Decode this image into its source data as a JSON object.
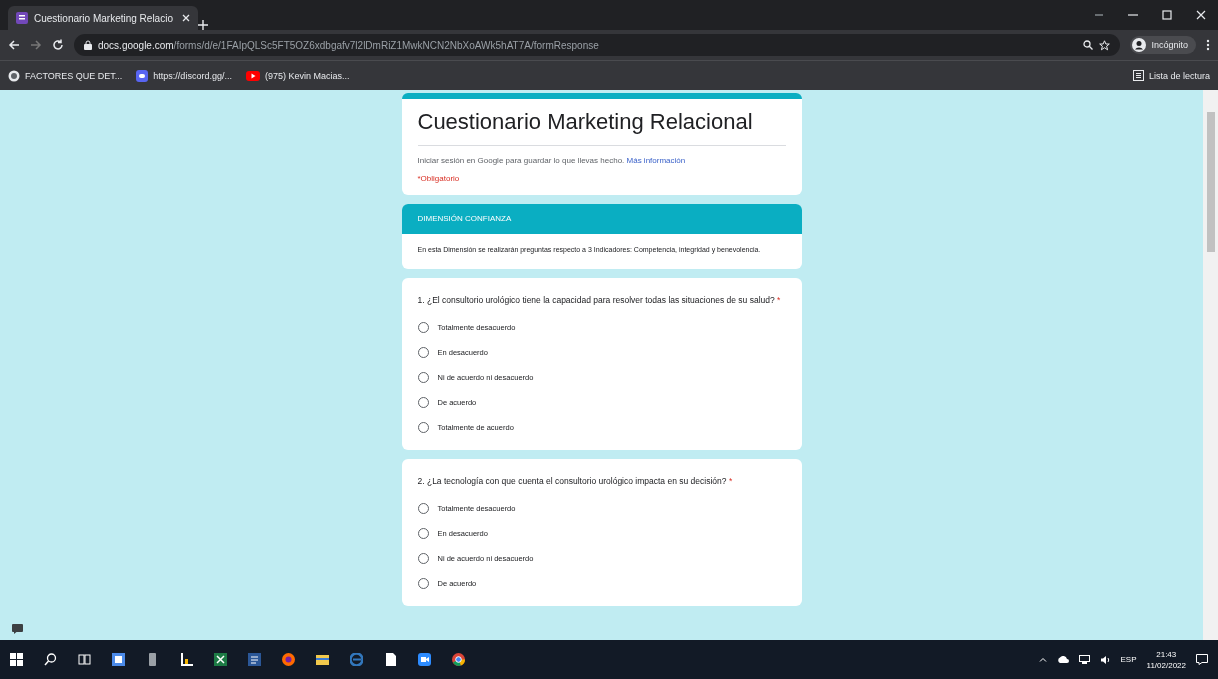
{
  "browser": {
    "tab_title": "Cuestionario Marketing Relacio",
    "url_host": "docs.google.com",
    "url_path": "/forms/d/e/1FAIpQLSc5FT5OZ6xdbgafv7l2lDmRiZ1MwkNCN2NbXoAWk5hAT7A/formResponse",
    "profile": "Incógnito",
    "reading_list": "Lista de lectura",
    "bookmarks": [
      {
        "kind": "site",
        "label": "FACTORES QUE DET..."
      },
      {
        "kind": "chat",
        "label": "https://discord.gg/..."
      },
      {
        "kind": "video",
        "label": "(975) Kevin Macias..."
      }
    ]
  },
  "form": {
    "title": "Cuestionario Marketing Relacional",
    "signin_note": "Iniciar sesión en Google para guardar lo que llevas hecho.",
    "signin_link": "Más información",
    "required_note": "*Obligatorio",
    "section": {
      "title": "DIMENSIÓN CONFIANZA",
      "description": "En esta Dimensión se realizarán preguntas respecto a 3 Indicadores: Competencia, integridad y benevolencia."
    },
    "questions": [
      {
        "text": "1. ¿El consultorio urológico tiene la capacidad para resolver todas las situaciones de su salud?",
        "required_mark": "*",
        "options": [
          {
            "label": "Totalmente desacuerdo",
            "selected": false
          },
          {
            "label": "En desacuerdo",
            "selected": false
          },
          {
            "label": "Ni de acuerdo ni desacuerdo",
            "selected": false
          },
          {
            "label": "De acuerdo",
            "selected": false
          },
          {
            "label": "Totalmente de acuerdo",
            "selected": false
          }
        ]
      },
      {
        "text": "2. ¿La tecnología con que cuenta el consultorio urológico impacta en su decisión?",
        "required_mark": "*",
        "options": [
          {
            "label": "Totalmente desacuerdo",
            "selected": false
          },
          {
            "label": "En desacuerdo",
            "selected": false
          },
          {
            "label": "Ni de acuerdo ni desacuerdo",
            "selected": false
          },
          {
            "label": "De acuerdo",
            "selected": false
          }
        ]
      }
    ]
  },
  "taskbar": {
    "language": "ESP",
    "time": "21:43",
    "date": "11/02/2022"
  }
}
